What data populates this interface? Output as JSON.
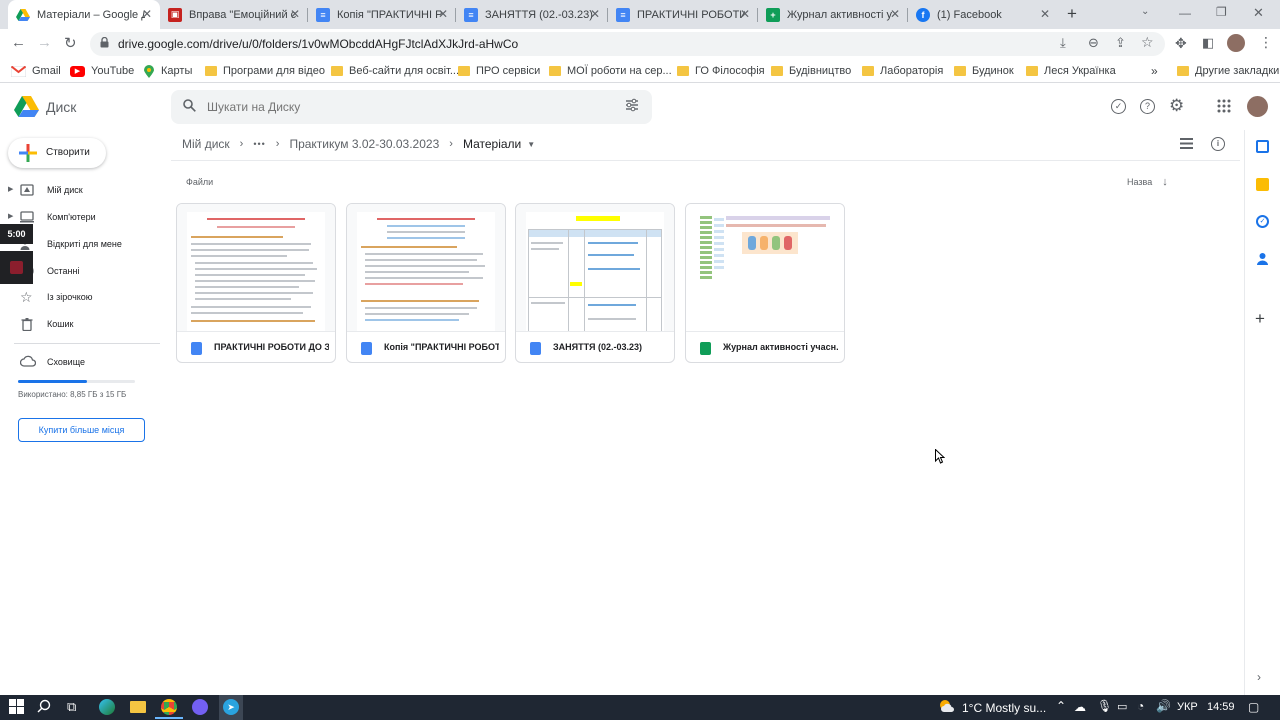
{
  "browser": {
    "tabs": [
      {
        "label": "Матеріали – Google Д",
        "icon": "google-drive-icon",
        "active": true
      },
      {
        "label": "Вправа \"Емоційний с",
        "icon": "presentation-icon",
        "active": false
      },
      {
        "label": "Копія \"ПРАКТИЧНІ Р",
        "icon": "docs-icon",
        "active": false
      },
      {
        "label": "ЗАНЯТТЯ (02.-03.23)",
        "icon": "docs-icon",
        "active": false
      },
      {
        "label": "ПРАКТИЧНІ РОБОТИ",
        "icon": "docs-icon",
        "active": false
      },
      {
        "label": "Журнал активності у",
        "icon": "sheets-icon",
        "active": false
      },
      {
        "label": "(1) Facebook",
        "icon": "facebook-icon",
        "active": false
      }
    ],
    "new_tab": "+",
    "url": "drive.google.com/drive/u/0/folders/1v0wMObcddAHgFJtclAdXJkJrd-aHwCo",
    "bookmarks": [
      {
        "label": "Gmail",
        "icon": "gmail-icon"
      },
      {
        "label": "YouTube",
        "icon": "youtube-icon"
      },
      {
        "label": "Карты",
        "icon": "maps-icon"
      },
      {
        "label": "Програми для відео",
        "icon": "folder-icon"
      },
      {
        "label": "Веб-сайти для освіт...",
        "icon": "folder-icon"
      },
      {
        "label": "ПРО сервіси",
        "icon": "folder-icon"
      },
      {
        "label": "МОЇ роботи на сер...",
        "icon": "folder-icon"
      },
      {
        "label": "ГО Філософія",
        "icon": "folder-icon"
      },
      {
        "label": "Будівництво",
        "icon": "folder-icon"
      },
      {
        "label": "Лабораторія",
        "icon": "folder-icon"
      },
      {
        "label": "Будинок",
        "icon": "folder-icon"
      },
      {
        "label": "Леся Українка",
        "icon": "folder-icon"
      }
    ],
    "bookmarks_more": "»",
    "other_bookmarks": "Другие закладки"
  },
  "drive": {
    "logo_text": "Диск",
    "search_placeholder": "Шукати на Диску",
    "new_button": "Створити",
    "nav": [
      {
        "label": "Мій диск",
        "icon": "my-drive-icon"
      },
      {
        "label": "Комп'ютери",
        "icon": "computer-icon"
      },
      {
        "label": "Відкриті для мене",
        "icon": "shared-icon"
      },
      {
        "label": "Останні",
        "icon": "recent-icon"
      },
      {
        "label": "Із зірочкою",
        "icon": "star-icon"
      },
      {
        "label": "Кошик",
        "icon": "trash-icon"
      }
    ],
    "storage_label": "Сховище",
    "storage_used_fraction": 0.59,
    "storage_text": "Використано: 8,85 ГБ з 15 ГБ",
    "buy_storage": "Купити більше місця",
    "breadcrumb": {
      "root": "Мій диск",
      "more": "•••",
      "parent": "Практикум 3.02-30.03.2023",
      "current": "Матеріали"
    },
    "section_files": "Файли",
    "sort_label": "Назва",
    "files": [
      {
        "name": "ПРАКТИЧНІ РОБОТИ ДО З...",
        "type": "docs"
      },
      {
        "name": "Копія \"ПРАКТИЧНІ РОБОТ...",
        "type": "docs"
      },
      {
        "name": "ЗАНЯТТЯ (02.-03.23)",
        "type": "docs"
      },
      {
        "name": "Журнал активності учасн...",
        "type": "sheets"
      }
    ],
    "overlay_timer": "5:00"
  },
  "taskbar": {
    "weather": "1°C  Mostly su...",
    "language": "УКР",
    "time": "14:59"
  },
  "colors": {
    "docs": "#4285f4",
    "sheets": "#0f9d58",
    "folder": "#f4c542",
    "storage_bar": "#1a73e8",
    "taskbar": "#1f2733"
  }
}
